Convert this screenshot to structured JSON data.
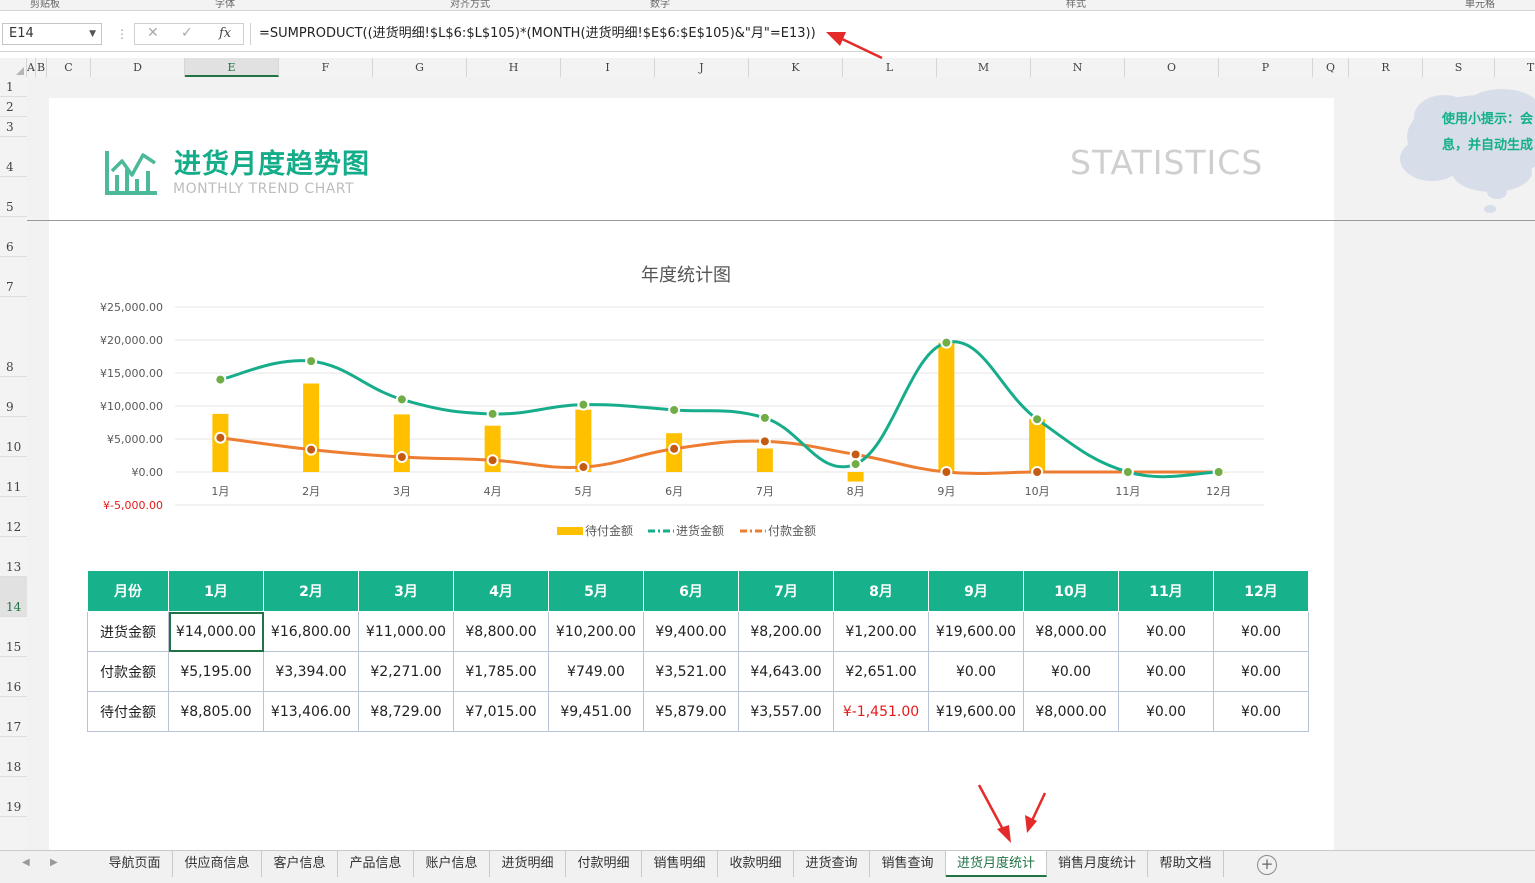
{
  "ribbon": {
    "groups": [
      "剪贴板",
      "字体",
      "对齐方式",
      "数字",
      "样式",
      "单元格"
    ]
  },
  "formula_bar": {
    "name_box": "E14",
    "cancel_icon": "close-icon",
    "enter_icon": "check-icon",
    "fx_label": "fx",
    "formula": "=SUMPRODUCT((进货明细!$L$6:$L$105)*(MONTH(进货明细!$E$6:$E$105)&\"月\"=E13))"
  },
  "columns": [
    "A",
    "B",
    "C",
    "D",
    "E",
    "F",
    "G",
    "H",
    "I",
    "J",
    "K",
    "L",
    "M",
    "N",
    "O",
    "P",
    "Q",
    "R",
    "S",
    "T"
  ],
  "rows": [
    "1",
    "2",
    "3",
    "4",
    "5",
    "6",
    "7",
    "8",
    "9",
    "10",
    "11",
    "12",
    "13",
    "14",
    "15",
    "16",
    "17",
    "18",
    "19"
  ],
  "header": {
    "title_cn": "进货月度趋势图",
    "title_en": "MONTHLY TREND CHART",
    "statistics": "STATISTICS",
    "tip_line1": "使用小提示：会",
    "tip_line2": "息，并自动生成"
  },
  "chart_data": {
    "type": "bar+line",
    "title": "年度统计图",
    "categories": [
      "1月",
      "2月",
      "3月",
      "4月",
      "5月",
      "6月",
      "7月",
      "8月",
      "9月",
      "10月",
      "11月",
      "12月"
    ],
    "y_ticks": [
      "¥25,000.00",
      "¥20,000.00",
      "¥15,000.00",
      "¥10,000.00",
      "¥5,000.00",
      "¥0.00",
      "¥-5,000.00"
    ],
    "ylim": [
      -5000,
      25000
    ],
    "series": [
      {
        "name": "待付金额",
        "kind": "bar",
        "color": "#ffc000",
        "values": [
          8805,
          13406,
          8729,
          7015,
          9451,
          5879,
          3557,
          -1451,
          19600,
          8000,
          0,
          0
        ]
      },
      {
        "name": "进货金额",
        "kind": "line",
        "color": "#17ad8a",
        "values": [
          14000,
          16800,
          11000,
          8800,
          10200,
          9400,
          8200,
          1200,
          19600,
          8000,
          0,
          0
        ]
      },
      {
        "name": "付款金额",
        "kind": "line",
        "color": "#ed7d31",
        "values": [
          5195,
          3394,
          2271,
          1785,
          749,
          3521,
          4643,
          2651,
          0,
          0,
          0,
          0
        ]
      }
    ],
    "legend_position": "bottom",
    "grid": true
  },
  "table": {
    "header": [
      "月份",
      "1月",
      "2月",
      "3月",
      "4月",
      "5月",
      "6月",
      "7月",
      "8月",
      "9月",
      "10月",
      "11月",
      "12月"
    ],
    "rows": [
      {
        "label": "进货金额",
        "cells": [
          "¥14,000.00",
          "¥16,800.00",
          "¥11,000.00",
          "¥8,800.00",
          "¥10,200.00",
          "¥9,400.00",
          "¥8,200.00",
          "¥1,200.00",
          "¥19,600.00",
          "¥8,000.00",
          "¥0.00",
          "¥0.00"
        ]
      },
      {
        "label": "付款金额",
        "cells": [
          "¥5,195.00",
          "¥3,394.00",
          "¥2,271.00",
          "¥1,785.00",
          "¥749.00",
          "¥3,521.00",
          "¥4,643.00",
          "¥2,651.00",
          "¥0.00",
          "¥0.00",
          "¥0.00",
          "¥0.00"
        ]
      },
      {
        "label": "待付金额",
        "cells": [
          "¥8,805.00",
          "¥13,406.00",
          "¥8,729.00",
          "¥7,015.00",
          "¥9,451.00",
          "¥5,879.00",
          "¥3,557.00",
          "¥-1,451.00",
          "¥19,600.00",
          "¥8,000.00",
          "¥0.00",
          "¥0.00"
        ]
      }
    ]
  },
  "tabs": [
    "导航页面",
    "供应商信息",
    "客户信息",
    "产品信息",
    "账户信息",
    "进货明细",
    "付款明细",
    "销售明细",
    "收款明细",
    "进货查询",
    "销售查询",
    "进货月度统计",
    "销售月度统计",
    "帮助文档"
  ],
  "active_tab": "进货月度统计",
  "colors": {
    "accent": "#17b28c",
    "excel_green": "#217346",
    "negative": "#e51b1b",
    "annotation_red": "#e52a2a"
  }
}
